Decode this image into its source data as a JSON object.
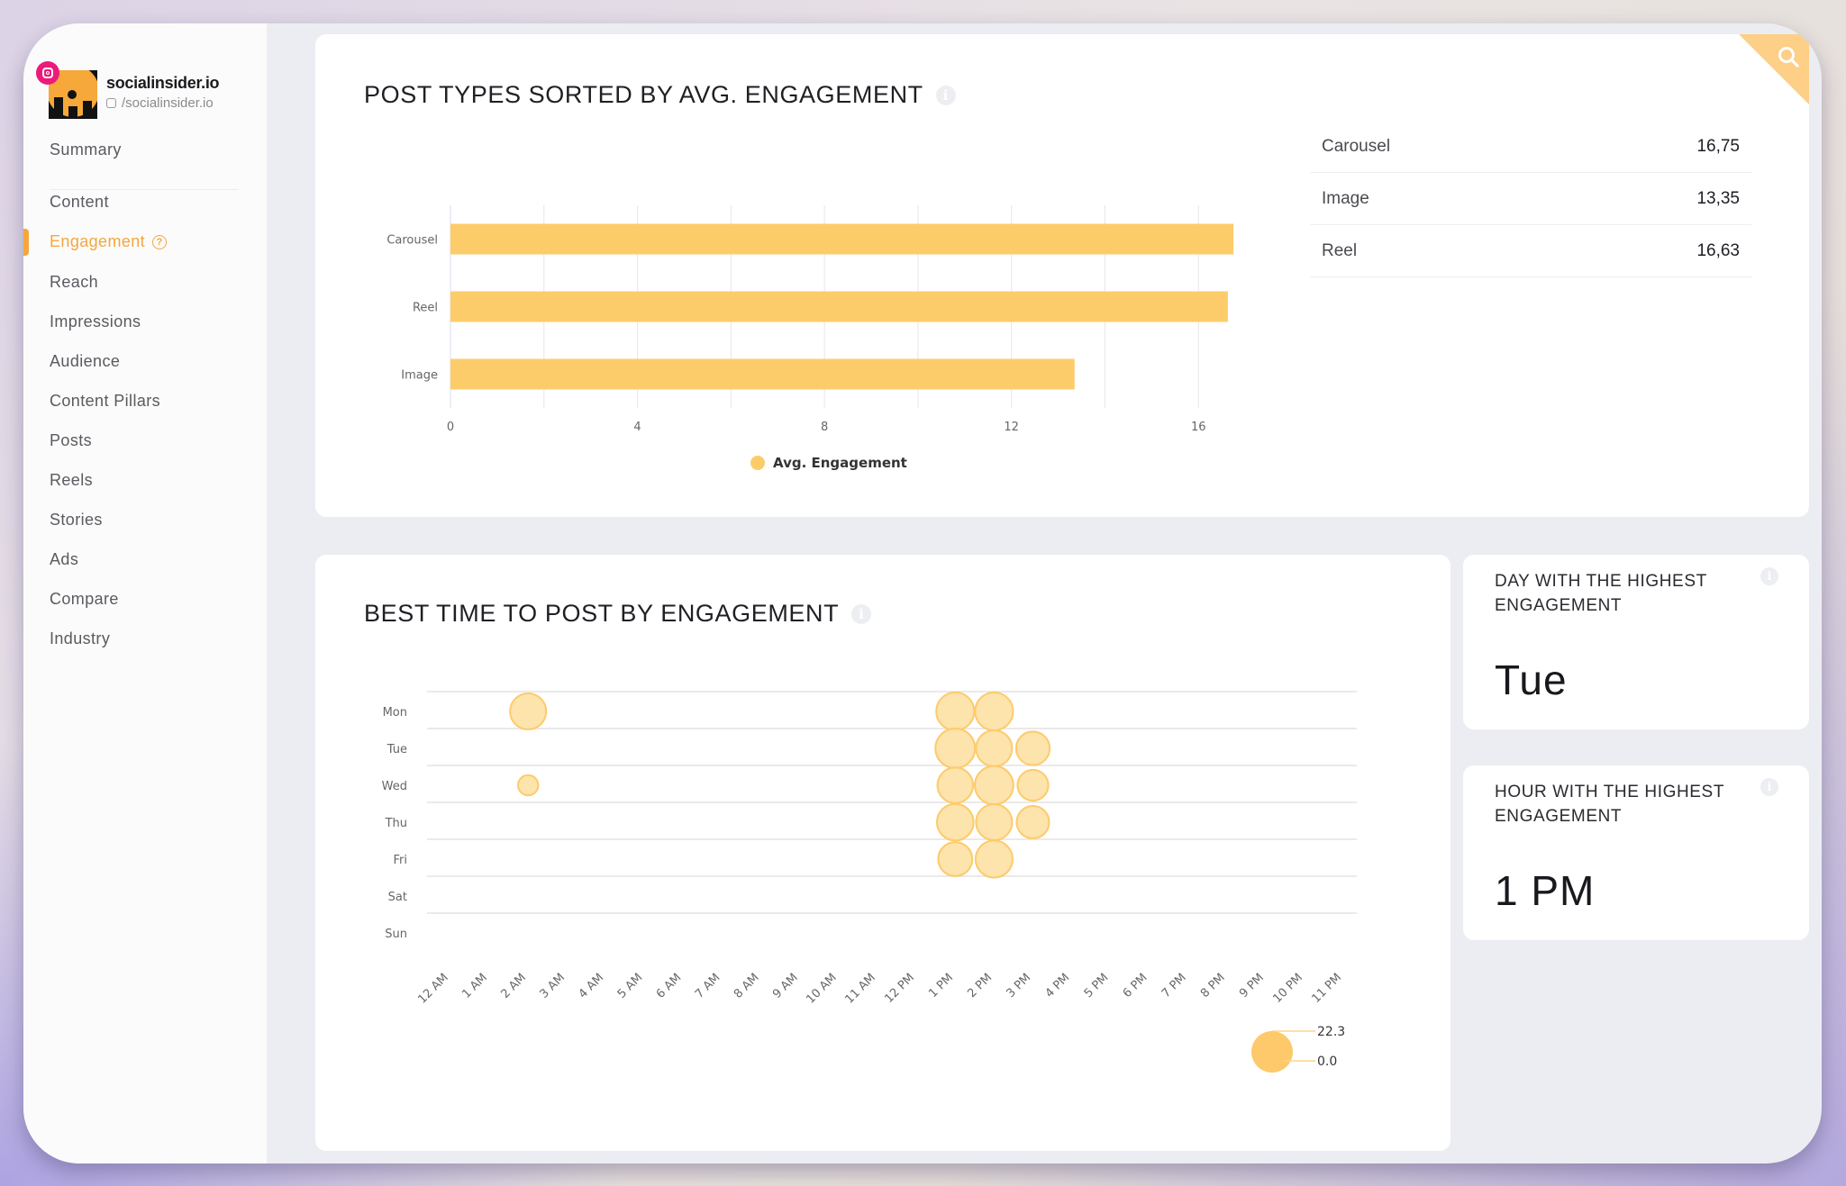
{
  "brand": {
    "name": "socialinsider.io",
    "handle": "/socialinsider.io",
    "network_icon": "instagram-icon"
  },
  "sidebar": {
    "items": [
      {
        "label": "Summary",
        "active": false
      },
      {
        "label": "Content",
        "active": false
      },
      {
        "label": "Engagement",
        "active": true,
        "help_icon": "?"
      },
      {
        "label": "Reach",
        "active": false
      },
      {
        "label": "Impressions",
        "active": false
      },
      {
        "label": "Audience",
        "active": false
      },
      {
        "label": "Content Pillars",
        "active": false
      },
      {
        "label": "Posts",
        "active": false
      },
      {
        "label": "Reels",
        "active": false
      },
      {
        "label": "Stories",
        "active": false
      },
      {
        "label": "Ads",
        "active": false
      },
      {
        "label": "Compare",
        "active": false
      },
      {
        "label": "Industry",
        "active": false
      }
    ]
  },
  "colors": {
    "accent": "#f5a63c",
    "bar": "#fdcc6a",
    "bubble_fill": "#fde2a8",
    "bubble_stroke": "#fccb6b",
    "corner": "#fdcf87"
  },
  "post_types_card": {
    "title": "POST TYPES SORTED BY AVG. ENGAGEMENT",
    "info_icon": "i",
    "search_icon": "search-icon",
    "table": [
      {
        "label": "Carousel",
        "value": "16,75"
      },
      {
        "label": "Image",
        "value": "13,35"
      },
      {
        "label": "Reel",
        "value": "16,63"
      }
    ]
  },
  "best_time_card": {
    "title": "BEST TIME TO POST BY ENGAGEMENT",
    "info_icon": "i"
  },
  "day_card": {
    "title": "DAY WITH THE HIGHEST ENGAGEMENT",
    "value": "Tue",
    "info_icon": "i"
  },
  "hour_card": {
    "title": "HOUR WITH THE HIGHEST ENGAGEMENT",
    "value": "1 PM",
    "info_icon": "i"
  },
  "chart_data": [
    {
      "type": "bar",
      "orientation": "horizontal",
      "title": "POST TYPES SORTED BY AVG. ENGAGEMENT",
      "categories": [
        "Carousel",
        "Reel",
        "Image"
      ],
      "series": [
        {
          "name": "Avg. Engagement",
          "values": [
            16.75,
            16.63,
            13.35
          ]
        }
      ],
      "xlim": [
        0,
        18
      ],
      "xticks": [
        0,
        4,
        8,
        12,
        16
      ],
      "grid_step": 2,
      "grid": true,
      "xlabel": "",
      "ylabel": "",
      "legend": {
        "position": "bottom-center",
        "entries": [
          "Avg. Engagement"
        ]
      }
    },
    {
      "type": "scatter",
      "subtype": "bubble",
      "title": "BEST TIME TO POST BY ENGAGEMENT",
      "y_categories": [
        "Mon",
        "Tue",
        "Wed",
        "Thu",
        "Fri",
        "Sat",
        "Sun"
      ],
      "x_categories": [
        "12 AM",
        "1 AM",
        "2 AM",
        "3 AM",
        "4 AM",
        "5 AM",
        "6 AM",
        "7 AM",
        "8 AM",
        "9 AM",
        "10 AM",
        "11 AM",
        "12 PM",
        "1 PM",
        "2 PM",
        "3 PM",
        "4 PM",
        "5 PM",
        "6 PM",
        "7 PM",
        "8 PM",
        "9 PM",
        "10 PM",
        "11 PM"
      ],
      "points": [
        {
          "day": "Mon",
          "hour": "2 AM",
          "value": 18.5
        },
        {
          "day": "Mon",
          "hour": "1 PM",
          "value": 20.5
        },
        {
          "day": "Mon",
          "hour": "2 PM",
          "value": 20.5
        },
        {
          "day": "Tue",
          "hour": "1 PM",
          "value": 22.3
        },
        {
          "day": "Tue",
          "hour": "2 PM",
          "value": 18.5
        },
        {
          "day": "Tue",
          "hour": "3 PM",
          "value": 16.0
        },
        {
          "day": "Wed",
          "hour": "2 AM",
          "value": 8.0
        },
        {
          "day": "Wed",
          "hour": "1 PM",
          "value": 18.0
        },
        {
          "day": "Wed",
          "hour": "2 PM",
          "value": 21.0
        },
        {
          "day": "Wed",
          "hour": "3 PM",
          "value": 13.5
        },
        {
          "day": "Thu",
          "hour": "1 PM",
          "value": 19.0
        },
        {
          "day": "Thu",
          "hour": "2 PM",
          "value": 18.5
        },
        {
          "day": "Thu",
          "hour": "3 PM",
          "value": 15.0
        },
        {
          "day": "Fri",
          "hour": "1 PM",
          "value": 16.5
        },
        {
          "day": "Fri",
          "hour": "2 PM",
          "value": 19.5
        }
      ],
      "size_legend": {
        "max": "22.3",
        "min": "0.0",
        "position": "bottom-right"
      },
      "grid": true
    }
  ]
}
